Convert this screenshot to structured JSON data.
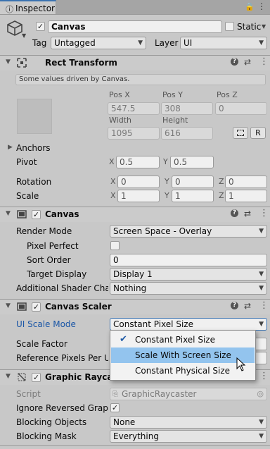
{
  "window": {
    "tab_title": "Inspector"
  },
  "gameobject": {
    "name": "Canvas",
    "static_label": "Static",
    "tag_label": "Tag",
    "tag_value": "Untagged",
    "layer_label": "Layer",
    "layer_value": "UI"
  },
  "rect_transform": {
    "title": "Rect Transform",
    "driven_note": "Some values driven by Canvas.",
    "pos_x_label": "Pos X",
    "pos_y_label": "Pos Y",
    "pos_z_label": "Pos Z",
    "pos_x": "547.5",
    "pos_y": "308",
    "pos_z": "0",
    "width_label": "Width",
    "height_label": "Height",
    "width": "1095",
    "height": "616",
    "raw_button": "R",
    "anchors_label": "Anchors",
    "pivot_label": "Pivot",
    "pivot_x": "0.5",
    "pivot_y": "0.5",
    "rotation_label": "Rotation",
    "rot_x": "0",
    "rot_y": "0",
    "rot_z": "0",
    "scale_label": "Scale",
    "scale_x": "1",
    "scale_y": "1",
    "scale_z": "1",
    "axis_x": "X",
    "axis_y": "Y",
    "axis_z": "Z"
  },
  "canvas": {
    "title": "Canvas",
    "render_mode_label": "Render Mode",
    "render_mode_value": "Screen Space - Overlay",
    "pixel_perfect_label": "Pixel Perfect",
    "sort_order_label": "Sort Order",
    "sort_order_value": "0",
    "target_display_label": "Target Display",
    "target_display_value": "Display 1",
    "shader_channels_label": "Additional Shader Chan",
    "shader_channels_value": "Nothing"
  },
  "canvas_scaler": {
    "title": "Canvas Scaler",
    "ui_scale_mode_label": "UI Scale Mode",
    "ui_scale_mode_value": "Constant Pixel Size",
    "scale_factor_label": "Scale Factor",
    "ref_ppu_label": "Reference Pixels Per Ur"
  },
  "scale_mode_menu": {
    "options": [
      "Constant Pixel Size",
      "Scale With Screen Size",
      "Constant Physical Size"
    ],
    "checked_index": 0,
    "highlighted_index": 1
  },
  "graphic_raycaster": {
    "title": "Graphic Raycas",
    "script_label": "Script",
    "script_value": "GraphicRaycaster",
    "ignore_reversed_label": "Ignore Reversed Graphi",
    "blocking_objects_label": "Blocking Objects",
    "blocking_objects_value": "None",
    "blocking_mask_label": "Blocking Mask",
    "blocking_mask_value": "Everything"
  },
  "colors": {
    "accent": "#3a72b0",
    "highlight": "#93c4ee",
    "panel": "#c8c8c8"
  }
}
